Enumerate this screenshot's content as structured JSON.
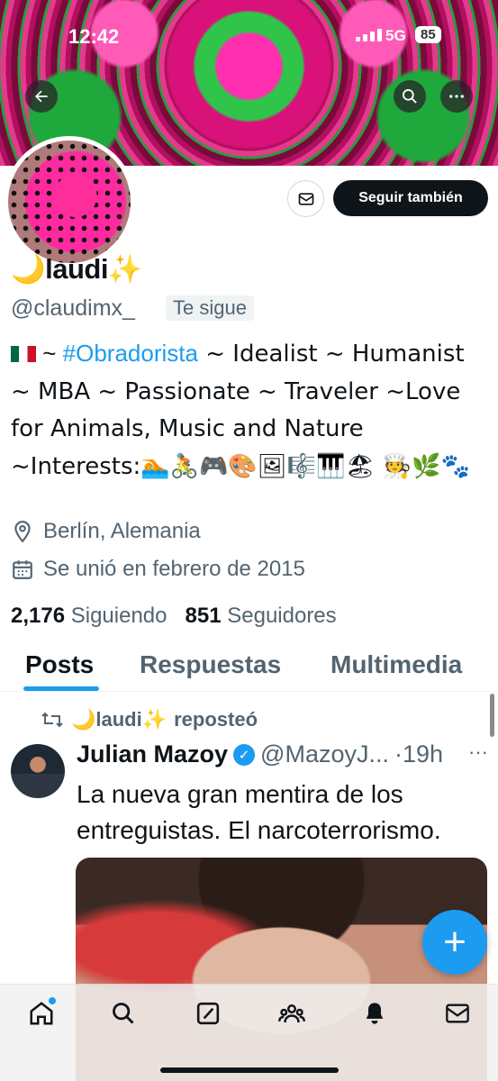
{
  "status_bar": {
    "time": "12:42",
    "network": "5G",
    "battery": "85"
  },
  "header": {
    "back_icon": "arrow-left-icon",
    "search_icon": "search-icon",
    "more_icon": "more-icon"
  },
  "profile": {
    "display_name": "🌙laudi✨",
    "handle": "@claudimx_",
    "follows_you": "Te sigue",
    "follow_button": "Seguir también",
    "bio": {
      "prefix": "~ ",
      "hashtag": "#Obradorista",
      "text": " ~ Idealist ~ Humanist ~ MBA ~ Passionate ~ Traveler ~Love for Animals, Music and Nature ~Interests:🏊🚴🎮🎨🖼🎼🎹🏖 🧑‍🍳🌿🐾"
    },
    "location": "Berlín, Alemania",
    "joined": "Se unió en febrero de 2015",
    "following_count": "2,176",
    "following_label": "Siguiendo",
    "followers_count": "851",
    "followers_label": "Seguidores"
  },
  "tabs": [
    "Posts",
    "Respuestas",
    "Multimedia"
  ],
  "post": {
    "repost_by": "🌙laudi✨",
    "repost_label": "reposteó",
    "author": "Julian Mazoy",
    "handle": "@MazoyJ...",
    "time": "·19h",
    "more": "···",
    "text": "La nueva gran mentira de los entreguistas. El narcoterrorismo."
  },
  "fab_label": "+",
  "bottom_nav": [
    "home-icon",
    "search-icon",
    "grok-icon",
    "communities-icon",
    "notifications-icon",
    "messages-icon"
  ],
  "colors": {
    "accent": "#1d9bf0",
    "text": "#0f1419",
    "secondary": "#536471"
  }
}
